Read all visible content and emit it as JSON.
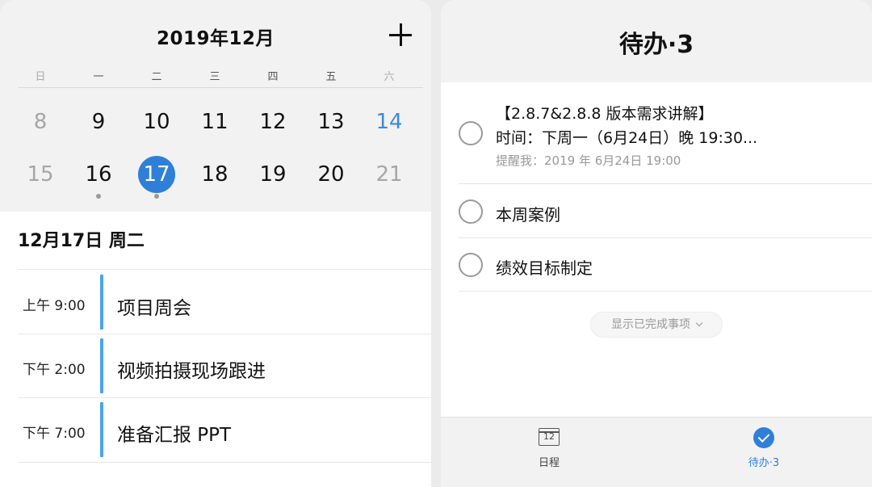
{
  "calendar": {
    "title": "2019年12月",
    "weekdays": [
      "日",
      "一",
      "二",
      "三",
      "四",
      "五",
      "六"
    ],
    "week1": [
      "8",
      "9",
      "10",
      "11",
      "12",
      "13",
      "14"
    ],
    "week2": [
      "15",
      "16",
      "17",
      "18",
      "19",
      "20",
      "21"
    ],
    "selected_day": "17",
    "accent_color": "#2f7fd9"
  },
  "day_view": {
    "date_heading": "12月17日 周二",
    "events": [
      {
        "time": "上午 9:00",
        "title": "项目周会"
      },
      {
        "time": "下午 2:00",
        "title": "视频拍摄现场跟进"
      },
      {
        "time": "下午 7:00",
        "title": "准备汇报 PPT"
      }
    ]
  },
  "todo": {
    "title": "待办·3",
    "items": [
      {
        "line1": "【2.8.7&2.8.8 版本需求讲解】",
        "line2": "时间：下周一（6月24日）晚 19:30...",
        "reminder": "提醒我：2019 年 6月24日 19:00"
      },
      {
        "title": "本周案例"
      },
      {
        "title": "绩效目标制定"
      }
    ],
    "show_completed": "显示已完成事项"
  },
  "tabbar": {
    "schedule_icon_text": "12",
    "schedule_label": "日程",
    "todo_label": "待办·3",
    "active_color": "#2f7fd9"
  }
}
